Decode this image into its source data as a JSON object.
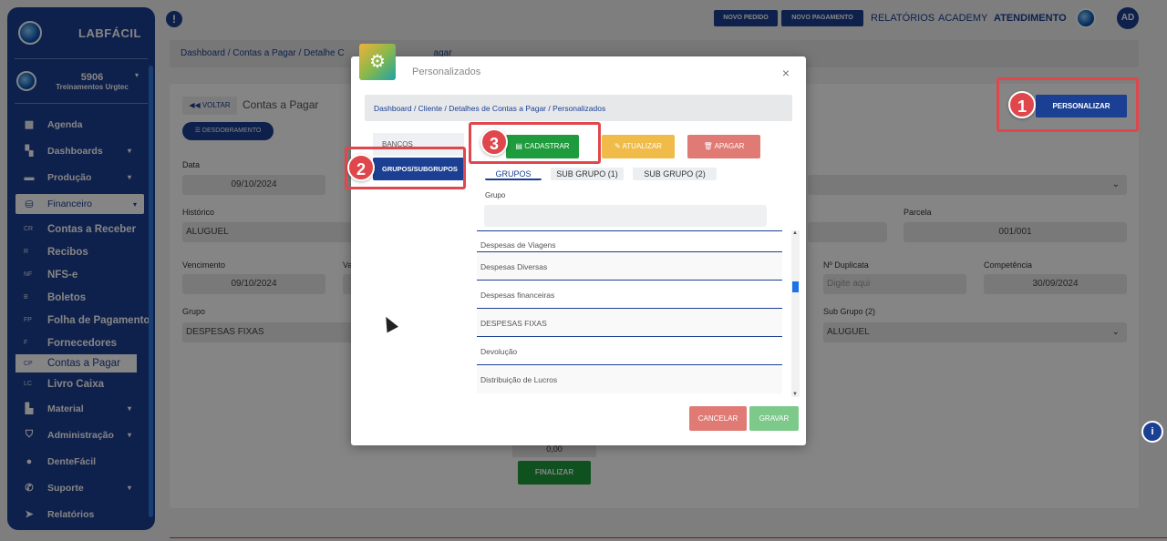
{
  "app": {
    "brand": "LABFÁCIL"
  },
  "sidebar": {
    "user_code": "5906",
    "user_name": "Treinamentos Urgtec",
    "items": [
      {
        "label": "Agenda",
        "icon": "calendar-icon",
        "caret": false
      },
      {
        "label": "Dashboards",
        "icon": "grid-icon",
        "caret": true
      },
      {
        "label": "Produção",
        "icon": "briefcase-icon",
        "caret": true
      },
      {
        "label": "Financeiro",
        "icon": "coins-icon",
        "caret": true,
        "active": true
      }
    ],
    "subitems": [
      {
        "abbr": "CR",
        "label": "Contas a Receber"
      },
      {
        "abbr": "R",
        "label": "Recibos"
      },
      {
        "abbr": "NF",
        "label": "NFS-e"
      },
      {
        "abbr": "B",
        "label": "Boletos"
      },
      {
        "abbr": "FP",
        "label": "Folha de Pagamento"
      },
      {
        "abbr": "F",
        "label": "Fornecedores"
      },
      {
        "abbr": "CP",
        "label": "Contas a Pagar",
        "active": true
      },
      {
        "abbr": "LC",
        "label": "Livro Caixa"
      }
    ],
    "items_bottom": [
      {
        "label": "Material",
        "icon": "boxes-icon",
        "caret": true
      },
      {
        "label": "Administração",
        "icon": "shield-icon",
        "caret": true
      },
      {
        "label": "DenteFácil",
        "icon": "tooth-icon",
        "caret": false
      },
      {
        "label": "Suporte",
        "icon": "phone-icon",
        "caret": true
      },
      {
        "label": "Relatórios",
        "icon": "paper-plane-icon",
        "caret": false
      }
    ]
  },
  "topbar": {
    "btn_novo_pedido": "NOVO PEDIDO",
    "btn_novo_pagamento": "NOVO PAGAMENTO",
    "link_relatorios": "RELATÓRIOS",
    "link_academy": "ACADEMY",
    "link_atendimento": "ATENDIMENTO",
    "avatar": "AD"
  },
  "page": {
    "breadcrumb": "Dashboard  /  Contas a Pagar  /  Detalhe C",
    "breadcrumb_tail": "agar",
    "back": "VOLTAR",
    "title": "Contas a Pagar",
    "desdobramento": "DESDOBRAMENTO",
    "personalizar": "PERSONALIZAR",
    "fields": {
      "data_label": "Data",
      "data_value": "09/10/2024",
      "historico_label": "Histórico",
      "historico_value": "ALUGUEL",
      "parcela_label": "Parcela",
      "parcela_value": "001/001",
      "vencimento_label": "Vencimento",
      "vencimento_value": "09/10/2024",
      "valor_label": "Va",
      "duplicata_label": "Nº Duplicata",
      "duplicata_placeholder": "Digite aqui",
      "competencia_label": "Competência",
      "competencia_value": "30/09/2024",
      "grupo_label": "Grupo",
      "grupo_value": "DESPESAS FIXAS",
      "subgrupo2_label": "Sub Grupo (2)",
      "subgrupo2_value": "ALUGUEL"
    },
    "total_value": "0,00",
    "finalizar": "FINALIZAR"
  },
  "modal": {
    "title": "Personalizados",
    "close": "×",
    "breadcrumb": "Dashboard  /  Cliente  /  Detalhes de Contas a Pagar  /  Personalizados",
    "left_tabs": [
      "BANCOS",
      "GRUPOS/SUBGRUPOS"
    ],
    "actions": {
      "cadastrar": "CADASTRAR",
      "atualizar": "ATUALIZAR",
      "apagar": "APAGAR"
    },
    "subtabs": [
      "GRUPOS",
      "SUB GRUPO (1)",
      "SUB GRUPO (2)"
    ],
    "grupo_label": "Grupo",
    "list": [
      "Despesas de Viagens",
      "Despesas Diversas",
      "Despesas financeiras",
      "DESPESAS FIXAS",
      "Devolução",
      "Distribuição de Lucros"
    ],
    "cancel": "CANCELAR",
    "save": "GRAVAR"
  },
  "annotations": {
    "step1": "1",
    "step2": "2",
    "step3": "3"
  },
  "colors": {
    "primary": "#1b3f92",
    "success": "#1e9b3c",
    "warning": "#f0bb48",
    "danger": "#e07a74",
    "highlight": "#e0474c"
  }
}
